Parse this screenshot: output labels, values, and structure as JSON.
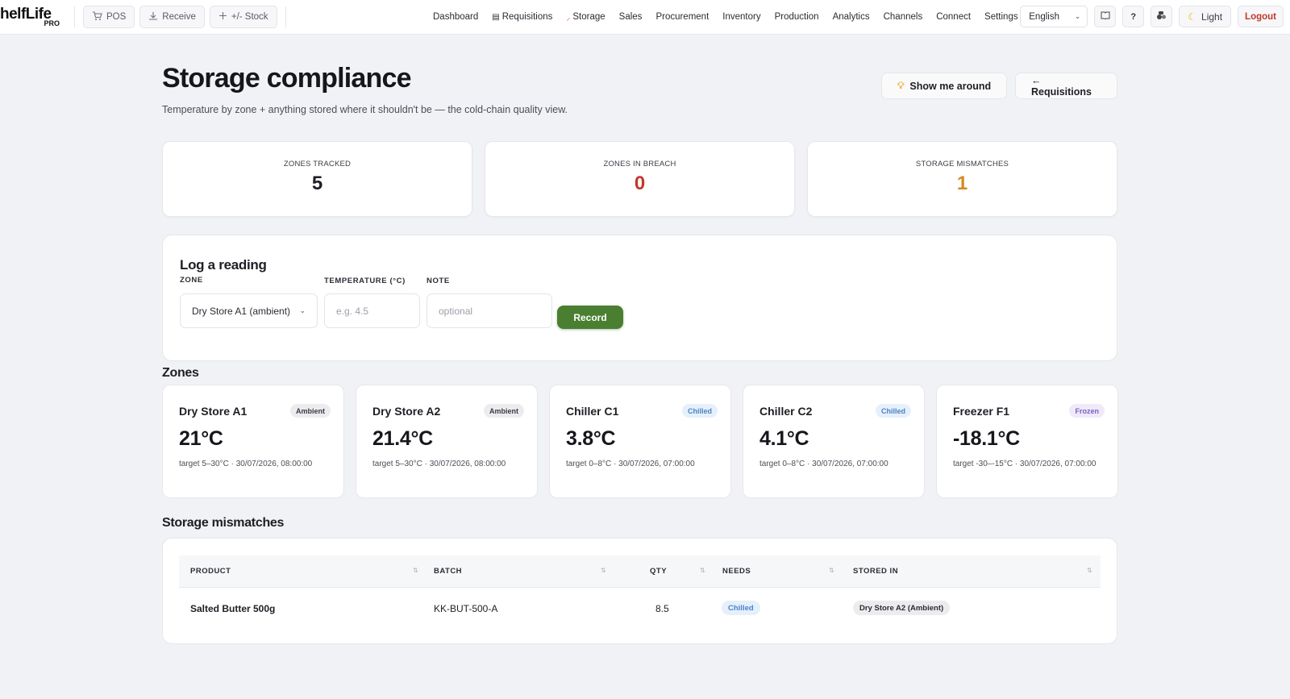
{
  "brand": {
    "name": "helfLife",
    "sub": "PRO"
  },
  "quick_actions": [
    {
      "icon": "cart-icon",
      "label": "POS"
    },
    {
      "icon": "download-icon",
      "label": "Receive"
    },
    {
      "icon": "plus-icon",
      "label": "+/- Stock"
    }
  ],
  "nav": [
    {
      "label": "Dashboard"
    },
    {
      "label": "Requisitions"
    },
    {
      "label": "Storage"
    },
    {
      "label": "Sales"
    },
    {
      "label": "Procurement"
    },
    {
      "label": "Inventory"
    },
    {
      "label": "Production"
    },
    {
      "label": "Analytics"
    },
    {
      "label": "Channels"
    },
    {
      "label": "Connect"
    },
    {
      "label": "Settings"
    }
  ],
  "toolbar": {
    "language": "English",
    "help": "?",
    "theme_label": "Light",
    "logout": "Logout"
  },
  "header": {
    "title": "Storage compliance",
    "subtitle": "Temperature by zone + anything stored where it shouldn't be — the cold-chain quality view.",
    "tour_button": "Show me around",
    "back_button": "← Requisitions"
  },
  "stats": [
    {
      "label": "ZONES TRACKED",
      "value": "5",
      "color": "#1d1f24"
    },
    {
      "label": "ZONES IN BREACH",
      "value": "0",
      "color": "#c0392b"
    },
    {
      "label": "STORAGE MISMATCHES",
      "value": "1",
      "color": "#d68a1e"
    }
  ],
  "log_reading": {
    "title": "Log a reading",
    "zone_label": "ZONE",
    "zone_value": "Dry Store A1 (ambient)",
    "temp_label": "TEMPERATURE (°C)",
    "temp_placeholder": "e.g. 4.5",
    "note_label": "NOTE",
    "note_placeholder": "optional",
    "record_button": "Record"
  },
  "zones_title": "Zones",
  "zones": [
    {
      "name": "Dry Store A1",
      "tag": "Ambient",
      "temp": "21°C",
      "meta": "target 5–30°C · 30/07/2026, 08:00:00"
    },
    {
      "name": "Dry Store A2",
      "tag": "Ambient",
      "temp": "21.4°C",
      "meta": "target 5–30°C · 30/07/2026, 08:00:00"
    },
    {
      "name": "Chiller C1",
      "tag": "Chilled",
      "temp": "3.8°C",
      "meta": "target 0–8°C · 30/07/2026, 07:00:00"
    },
    {
      "name": "Chiller C2",
      "tag": "Chilled",
      "temp": "4.1°C",
      "meta": "target 0–8°C · 30/07/2026, 07:00:00"
    },
    {
      "name": "Freezer F1",
      "tag": "Frozen",
      "temp": "-18.1°C",
      "meta": "target -30–-15°C · 30/07/2026, 07:00:00"
    }
  ],
  "mismatches": {
    "title": "Storage mismatches",
    "columns": [
      "PRODUCT",
      "BATCH",
      "QTY",
      "NEEDS",
      "STORED IN"
    ],
    "rows": [
      {
        "product": "Salted Butter 500g",
        "batch": "KK-BUT-500-A",
        "qty": "8.5",
        "needs": "Chilled",
        "stored_in": "Dry Store A2 (Ambient)"
      }
    ]
  }
}
